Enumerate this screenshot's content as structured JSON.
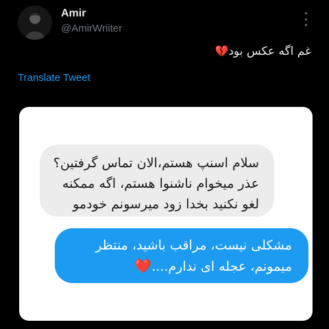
{
  "author": {
    "display_name": "Amir",
    "handle": "@AmirWriiter",
    "avatar_icon": "person-silhouette-icon"
  },
  "menu": {
    "icon": "more-options-icon"
  },
  "tweet": {
    "text": "غم اگه عکس بود",
    "emoji": "💔",
    "translate_label": "Translate Tweet"
  },
  "media": {
    "received_lines": [
      "سلام اسنپ هستم،الان تماس گرفتین؟",
      "عذر میخوام ناشنوا هستم، اگه ممکنه",
      "لغو نکنید بخدا زود میرسونم خودمو"
    ],
    "sent_lines": [
      "مشکلی نیست، مراقب باشید، منتظر",
      "میمونم، عجله ای ندارم...."
    ],
    "sent_emoji": "❤️"
  },
  "colors": {
    "background": "#000000",
    "link": "#1d9bf0",
    "sent_bubble": "#1c9bf0",
    "received_bubble": "#ececec"
  }
}
